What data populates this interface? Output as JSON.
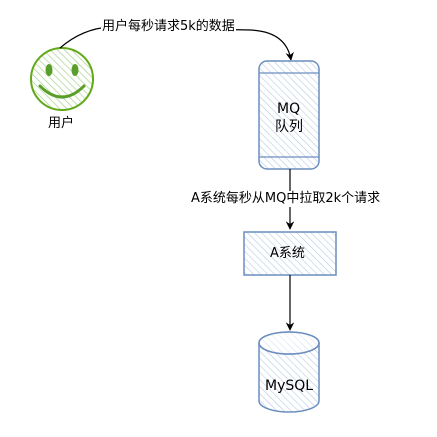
{
  "diagram": {
    "user": {
      "label": "用户",
      "icon": "smiley-face-icon",
      "color": "#60a917"
    },
    "edge_user_to_mq": "用户每秒请求5k的数据",
    "mq": {
      "line1": "MQ",
      "line2": "队列",
      "color": "#6c8ebf"
    },
    "edge_mq_to_system": "A系统每秒从MQ中拉取2k个请求",
    "system_a": {
      "label": "A系统",
      "color": "#6c8ebf"
    },
    "database": {
      "label": "MySQL",
      "icon": "database-cylinder-icon",
      "color": "#6c8ebf"
    }
  }
}
